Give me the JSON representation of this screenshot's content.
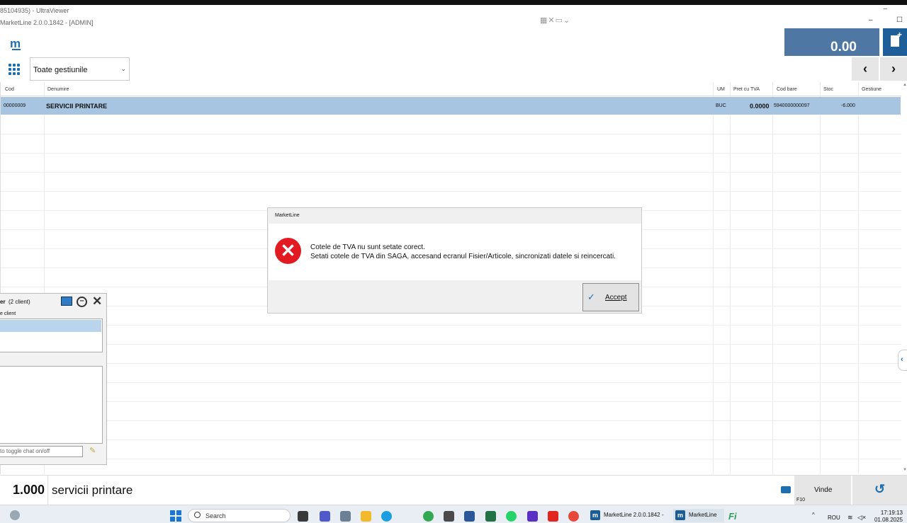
{
  "remote": {
    "window_title": "85104935) - UltraViewer",
    "tools": "▦✕▭⌄"
  },
  "app": {
    "title": "MarketLine 2.0.0.1842 - [ADMIN]",
    "logo_text": "m",
    "total": "0.00",
    "store_select": "Toate gestiunile",
    "accent_color": "#1d6fb0"
  },
  "grid": {
    "columns": [
      "Cod",
      "Denumire",
      "UM",
      "Pret cu TVA",
      "Cod bare",
      "Stoc",
      "Gestiune"
    ],
    "rows": [
      {
        "cod": "00000009",
        "denumire": "SERVICII PRINTARE",
        "um": "BUC",
        "pret": "0.0000",
        "cod_bare": "5940000000097",
        "stoc": "-6.000",
        "gestiune": ""
      }
    ]
  },
  "dialog": {
    "title": "MarketLine",
    "message_line1": "Cotele de TVA nu sunt setate corect.",
    "message_line2": "Setati cotele de TVA din SAGA, accesand ecranul Fisier/Articole, sincronizati datele si reincercati.",
    "accept_label": "Accept",
    "error_color": "#e21b23"
  },
  "uv_panel": {
    "title_bold": "er",
    "title_rest": "(2 client)",
    "column_header": "e client",
    "chat_hint": "to toggle chat on/off"
  },
  "bottom": {
    "quantity": "1.000",
    "product": "servicii printare",
    "sell_label": "Vinde",
    "sell_key": "F10"
  },
  "taskbar": {
    "search_label": "Search",
    "task1": "MarketLine 2.0.0.1842 -",
    "task2": "MarketLine",
    "lang": "ROU",
    "time": "17:19:13",
    "date": "01.08.2025"
  }
}
